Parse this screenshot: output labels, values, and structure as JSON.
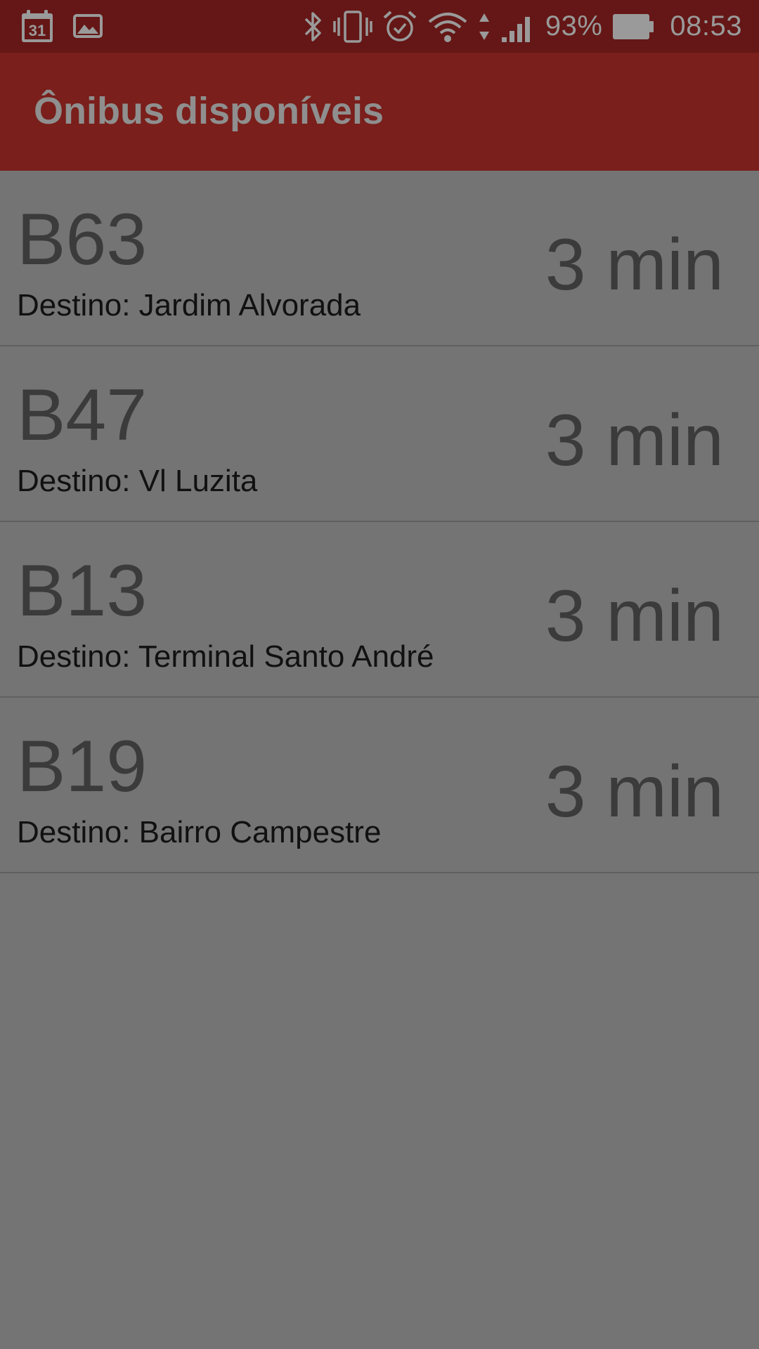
{
  "status_bar": {
    "calendar_day": "31",
    "battery": "93%",
    "time": "08:53",
    "icons_left": [
      "calendar-icon",
      "gallery-icon"
    ],
    "icons_right": [
      "bluetooth-icon",
      "vibrate-icon",
      "alarm-icon",
      "wifi-icon",
      "data-arrows-icon",
      "signal-icon",
      "battery-icon"
    ]
  },
  "app_bar": {
    "title": "Ônibus disponíveis",
    "background": "#7a1f1b"
  },
  "buses": [
    {
      "route": "B63",
      "destination": "Destino: Jardim Alvorada",
      "eta": "3 min"
    },
    {
      "route": "B47",
      "destination": "Destino: Vl Luzita",
      "eta": "3 min"
    },
    {
      "route": "B13",
      "destination": "Destino: Terminal Santo André",
      "eta": "3 min"
    },
    {
      "route": "B19",
      "destination": "Destino: Bairro Campestre",
      "eta": "3 min"
    }
  ],
  "colors": {
    "status_bar": "#641716",
    "list_background": "#747474",
    "divider": "#606060"
  }
}
